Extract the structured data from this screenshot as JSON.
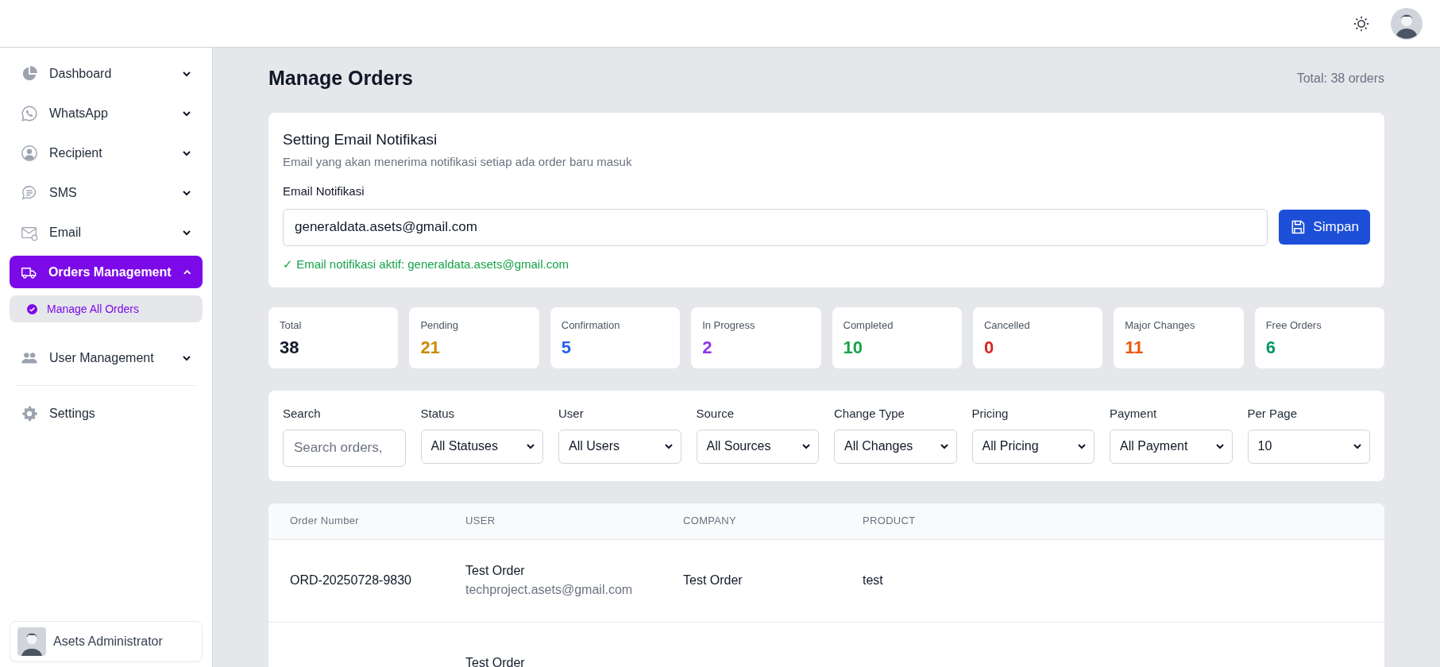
{
  "sidebar": {
    "items": [
      {
        "label": "Dashboard",
        "expanded": false,
        "selected": false
      },
      {
        "label": "WhatsApp",
        "expanded": false,
        "selected": false
      },
      {
        "label": "Recipient",
        "expanded": false,
        "selected": false
      },
      {
        "label": "SMS",
        "expanded": false,
        "selected": false
      },
      {
        "label": "Email",
        "expanded": false,
        "selected": false
      },
      {
        "label": "Orders Management",
        "expanded": true,
        "selected": true,
        "children": [
          {
            "label": "Manage All Orders",
            "selected": true
          }
        ]
      },
      {
        "label": "User Management",
        "expanded": false,
        "selected": false
      }
    ],
    "footer_items": [
      {
        "label": "Settings"
      }
    ],
    "account": {
      "name": "Asets Administrator"
    }
  },
  "page": {
    "title": "Manage Orders",
    "total": "Total: 38 orders"
  },
  "email_settings": {
    "title": "Setting Email Notifikasi",
    "subtitle": "Email yang akan menerima notifikasi setiap ada order baru masuk",
    "field_label": "Email Notifikasi",
    "value": "generaldata.asets@gmail.com",
    "button": "Simpan",
    "status": "✓ Email notifikasi aktif: generaldata.asets@gmail.com"
  },
  "stats": [
    {
      "label": "Total",
      "value": "38",
      "color": "#111827"
    },
    {
      "label": "Pending",
      "value": "21",
      "color": "#ca8a04"
    },
    {
      "label": "Confirmation",
      "value": "5",
      "color": "#2563eb"
    },
    {
      "label": "In Progress",
      "value": "2",
      "color": "#9333ea"
    },
    {
      "label": "Completed",
      "value": "10",
      "color": "#16a34a"
    },
    {
      "label": "Cancelled",
      "value": "0",
      "color": "#dc2626"
    },
    {
      "label": "Major Changes",
      "value": "11",
      "color": "#ea580c"
    },
    {
      "label": "Free Orders",
      "value": "6",
      "color": "#059669"
    }
  ],
  "filters": [
    {
      "kind": "search",
      "label": "Search",
      "placeholder": "Search orders,"
    },
    {
      "kind": "select",
      "label": "Status",
      "value": "All Statuses"
    },
    {
      "kind": "select",
      "label": "User",
      "value": "All Users"
    },
    {
      "kind": "select",
      "label": "Source",
      "value": "All Sources"
    },
    {
      "kind": "select",
      "label": "Change Type",
      "value": "All Changes"
    },
    {
      "kind": "select",
      "label": "Pricing",
      "value": "All Pricing"
    },
    {
      "kind": "select",
      "label": "Payment",
      "value": "All Payment"
    },
    {
      "kind": "select",
      "label": "Per Page",
      "value": "10"
    }
  ],
  "table": {
    "columns": [
      "Order Number",
      "USER",
      "COMPANY",
      "PRODUCT"
    ],
    "rows": [
      {
        "order_number": "ORD-20250728-9830",
        "user_name": "Test Order",
        "user_email": "techproject.asets@gmail.com",
        "company": "Test Order",
        "product": "test"
      },
      {
        "user_name": "Test Order"
      }
    ]
  }
}
